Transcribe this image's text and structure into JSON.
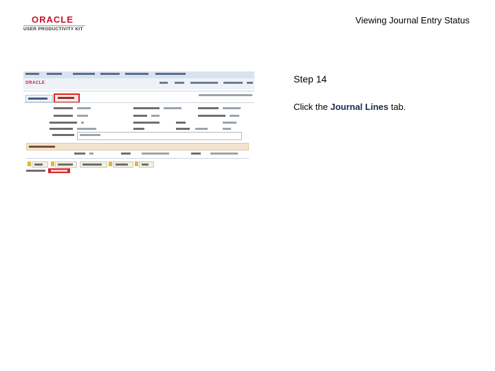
{
  "logo": {
    "brand": "ORACLE",
    "product": "USER PRODUCTIVITY KIT"
  },
  "header": {
    "title": "Viewing Journal Entry Status"
  },
  "step": {
    "label": "Step 14"
  },
  "instruction": {
    "prefix": "Click the ",
    "target": "Journal Lines",
    "suffix": " tab."
  },
  "screenshot": {
    "brand": "ORACLE"
  },
  "colors": {
    "brand_red": "#c8102e",
    "highlight_red": "#e02020",
    "target_text": "#1d2a4f"
  }
}
